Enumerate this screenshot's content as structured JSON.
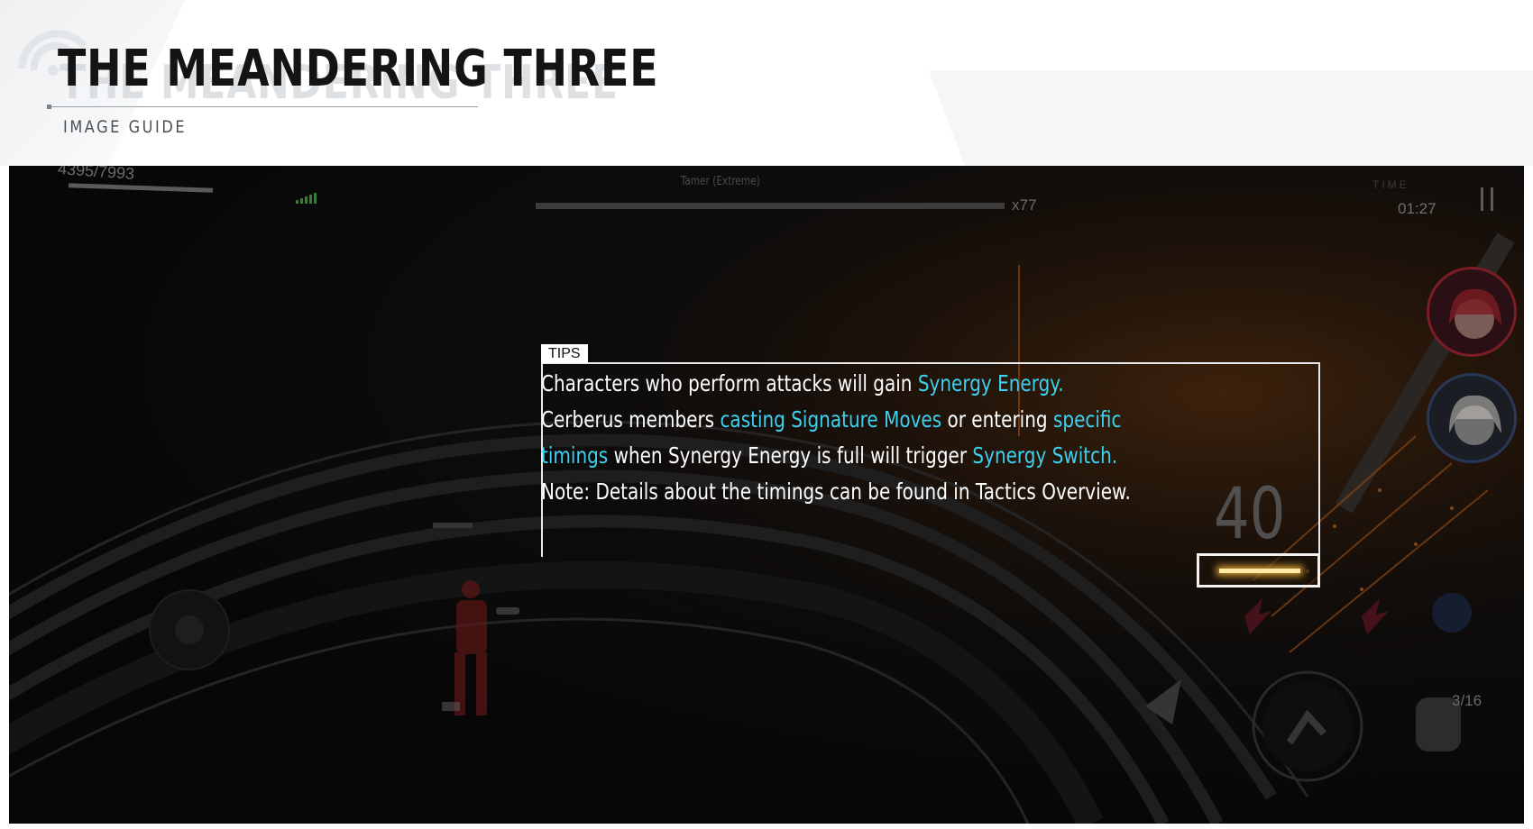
{
  "header": {
    "title": "THE MEANDERING THREE",
    "subtitle": "IMAGE GUIDE"
  },
  "hud": {
    "hp": "4395/7993",
    "boss_name": "Tamer (Extreme)",
    "boss_multiplier": "x77",
    "timer_label": "TIME",
    "timer": "01:27",
    "energy_value": "40",
    "ammo": "3/16"
  },
  "tips": {
    "tag": "TIPS",
    "line1": {
      "t1": "Characters who perform attacks will gain ",
      "h1": "Synergy Energy."
    },
    "line2": {
      "t1": "Cerberus members ",
      "h1": "casting Signature Moves",
      "t2": " or entering ",
      "h2": "specific"
    },
    "line3": {
      "h1": "timings",
      "t1": " when Synergy Energy is full will trigger ",
      "h2": "Synergy Switch."
    },
    "line4": "Note: Details about the timings can be found in Tactics Overview."
  },
  "colors": {
    "highlight": "#3dd0ef",
    "title": "#141414",
    "frame": "#e9e9e9"
  },
  "icons": [
    "signal-icon",
    "pause-icon",
    "character-portrait",
    "dodge-icon",
    "ultimate-icon",
    "skill-icon",
    "attack-icon",
    "punch-icon",
    "joystick-icon"
  ]
}
